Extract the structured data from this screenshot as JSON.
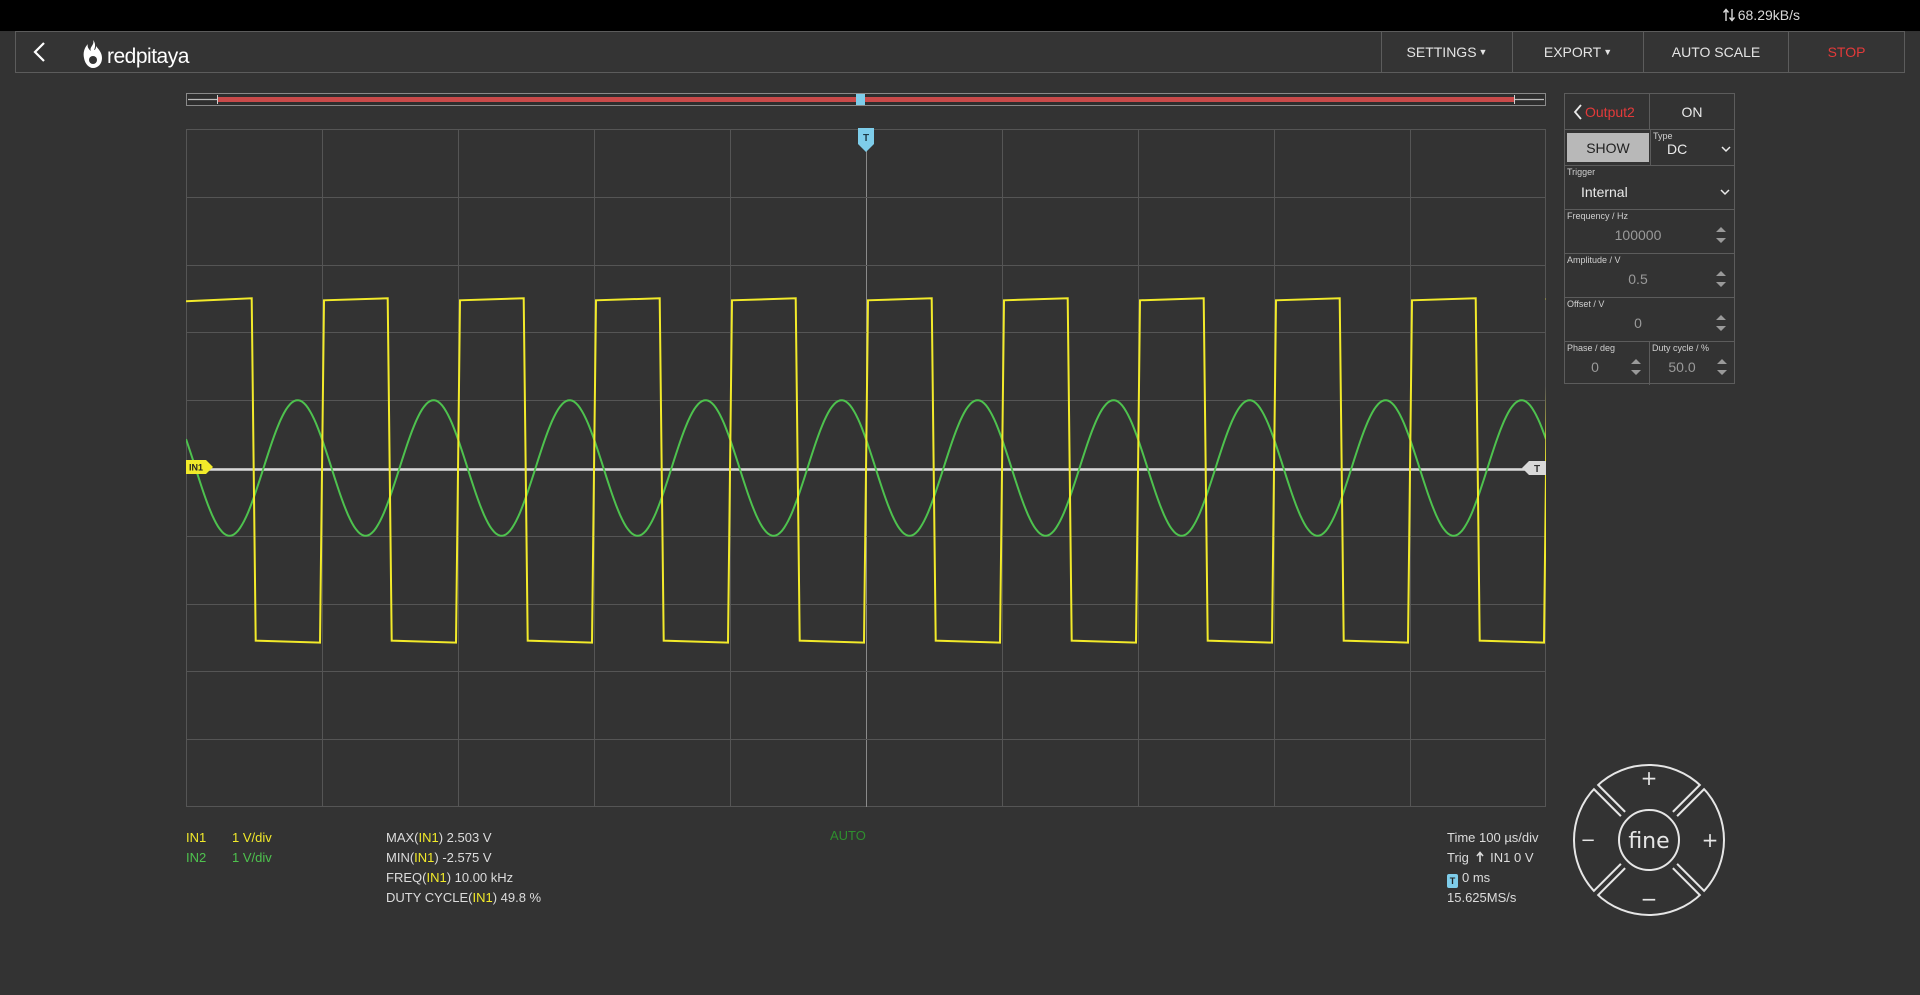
{
  "status_bar": {
    "speed": "68.29kB/s"
  },
  "navbar": {
    "logo_text": "redpitaya",
    "settings_label": "SETTINGS",
    "export_label": "EXPORT",
    "autoscale_label": "AUTO SCALE",
    "stop_label": "STOP"
  },
  "scope": {
    "trigger_marker": "T",
    "channel_marker": "IN1",
    "trigger_level_marker": "T"
  },
  "output_panel": {
    "output_name": "Output2",
    "on_label": "ON",
    "show_label": "SHOW",
    "type_label": "Type",
    "type_value": "DC",
    "trigger_label": "Trigger",
    "trigger_value": "Internal",
    "frequency_label": "Frequency / Hz",
    "frequency_value": "100000",
    "amplitude_label": "Amplitude / V",
    "amplitude_value": "0.5",
    "offset_label": "Offset / V",
    "offset_value": "0",
    "phase_label": "Phase / deg",
    "phase_value": "0",
    "duty_label": "Duty cycle / %",
    "duty_value": "50.0"
  },
  "channels": [
    {
      "name": "IN1",
      "scale": "1 V/div",
      "color": "#f2ea2a"
    },
    {
      "name": "IN2",
      "scale": "1 V/div",
      "color": "#4ec24e"
    }
  ],
  "measurements": {
    "max_prefix": "MAX(",
    "max_ch": "IN1",
    "max_value": ") 2.503 V",
    "min_prefix": "MIN(",
    "min_ch": "IN1",
    "min_value": ") -2.575 V",
    "freq_prefix": "FREQ(",
    "freq_ch": "IN1",
    "freq_value": ") 10.00 kHz",
    "duty_prefix": "DUTY CYCLE(",
    "duty_ch": "IN1",
    "duty_value": ") 49.8 %"
  },
  "trigger_mode": "AUTO",
  "acquisition": {
    "time": "Time 100 µs/div",
    "trig": "Trig",
    "trig_source": "IN1 0 V",
    "t_badge": "T",
    "t_offset": "0 ms",
    "sample_rate": "15.625MS/s"
  },
  "nav_pad": {
    "center_label": "fine",
    "up": "+",
    "down": "−",
    "left": "−",
    "right": "+"
  },
  "waveforms": {
    "grid_divisions": {
      "x": 10,
      "y": 10
    },
    "volts_per_div": 1,
    "time_per_div_us": 100,
    "in1": {
      "type": "square",
      "high_v": 2.503,
      "low_v": -2.575,
      "frequency_khz": 10.0,
      "duty_pct": 49.8,
      "color": "#f2ea2a"
    },
    "in2": {
      "type": "sine",
      "amplitude_v": 1.0,
      "frequency_khz": 10.0,
      "color": "#4ec24e"
    },
    "trigger_color": "#7ecdea",
    "baseline_color": "#d9d9d9"
  }
}
